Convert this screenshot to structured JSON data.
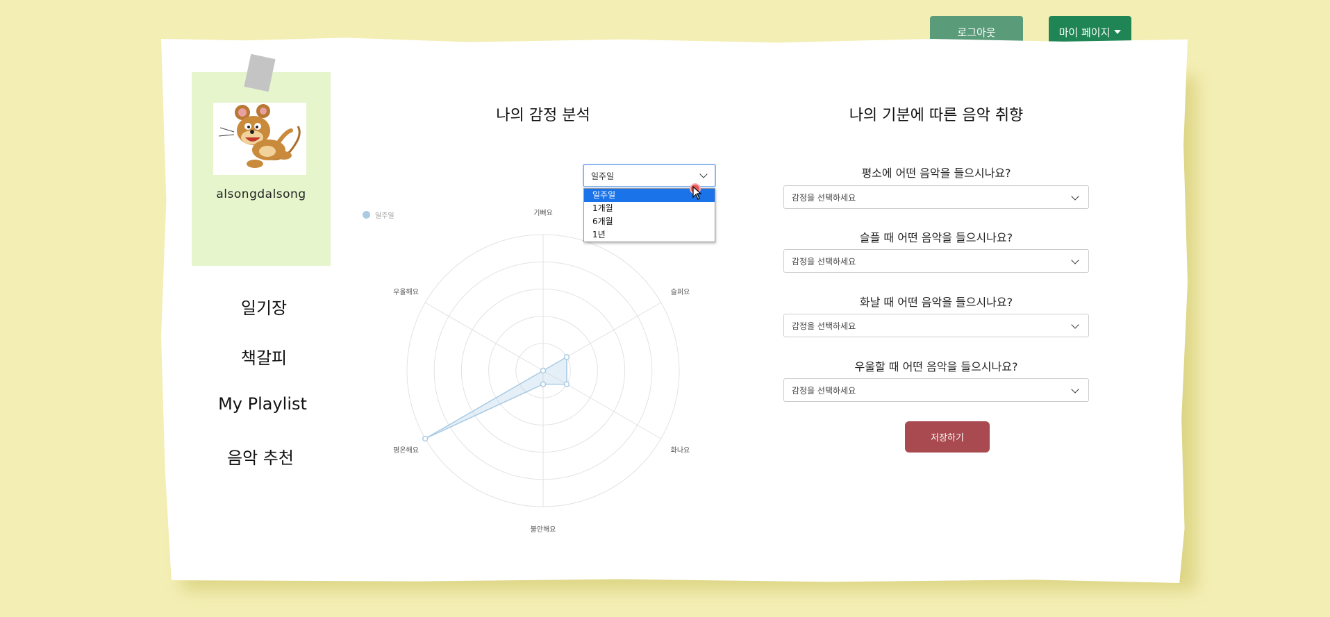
{
  "header": {
    "logout_label": "로그아웃",
    "mypage_label": "마이 페이지"
  },
  "profile": {
    "username": "alsongdalsong",
    "avatar_icon": "cartoon-mouse-avatar"
  },
  "nav": {
    "items": [
      {
        "label": "일기장"
      },
      {
        "label": "책갈피"
      },
      {
        "label": "My Playlist"
      },
      {
        "label": "음악 추천"
      }
    ]
  },
  "emotion_analysis": {
    "title": "나의 감정 분석",
    "period_select": {
      "selected": "일주일",
      "options": [
        "일주일",
        "1개월",
        "6개월",
        "1년"
      ]
    }
  },
  "chart_data": {
    "type": "radar",
    "series": [
      {
        "name": "일주일",
        "values": [
          0,
          0.2,
          0.2,
          0.1,
          1.0,
          0
        ],
        "color": "#a9cbe4"
      }
    ],
    "categories": [
      "기뻐요",
      "슬퍼요",
      "화나요",
      "불안해요",
      "평온해요",
      "우울해요"
    ],
    "rmax": 1,
    "grid": true,
    "legend": "top-left"
  },
  "music_pref": {
    "title": "나의 기분에 따른 음악 취향",
    "questions": [
      {
        "label": "평소에 어떤 음악을 들으시나요?",
        "placeholder": "감정을 선택하세요"
      },
      {
        "label": "슬플 때 어떤 음악을 들으시나요?",
        "placeholder": "감정을 선택하세요"
      },
      {
        "label": "화날 때 어떤 음악을 들으시나요?",
        "placeholder": "감정을 선택하세요"
      },
      {
        "label": "우울할 때 어떤 음악을 들으시나요?",
        "placeholder": "감정을 선택하세요"
      }
    ],
    "save_label": "저장하기"
  }
}
